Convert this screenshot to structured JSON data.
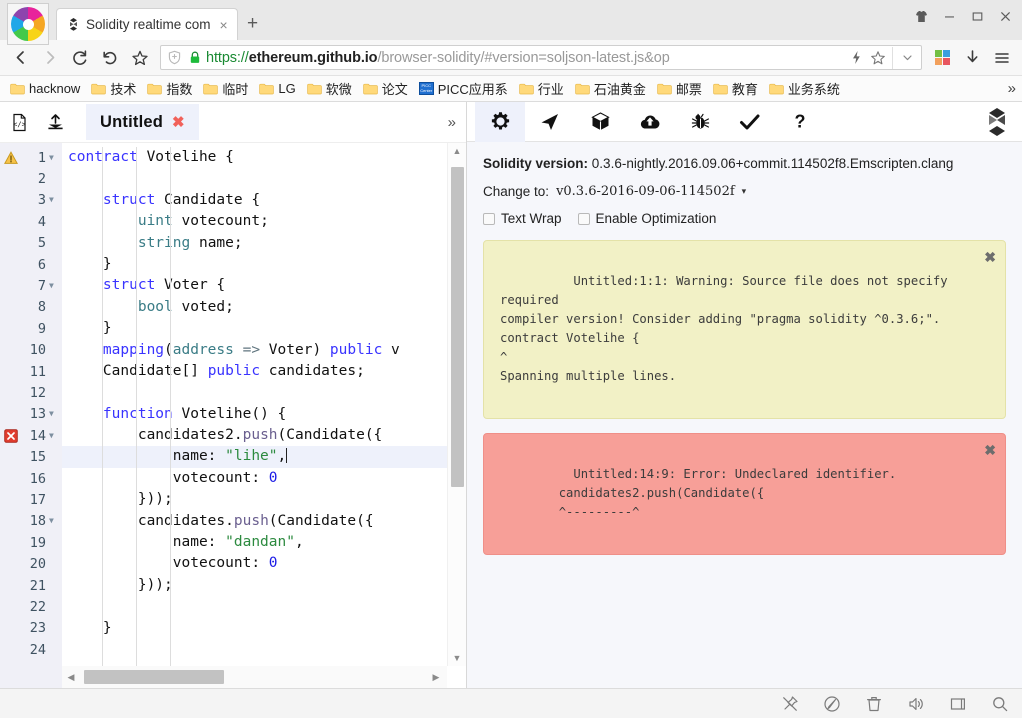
{
  "browser": {
    "logo_icon": "pinwheel-logo",
    "tab": {
      "title": "Solidity realtime com",
      "favicon_icon": "solidity-favicon",
      "close_label": "×"
    },
    "new_tab_label": "+",
    "window_controls": [
      {
        "name": "theme-shirt-icon",
        "label": "theme"
      },
      {
        "name": "minimize-button",
        "label": "minimize"
      },
      {
        "name": "maximize-button",
        "label": "maximize"
      },
      {
        "name": "close-button",
        "label": "close"
      }
    ],
    "nav": {
      "back_icon": "back-arrow-icon",
      "forward_icon": "forward-arrow-icon",
      "reload_icon": "reload-icon",
      "undo_icon": "undo-icon",
      "star_icon": "star-icon"
    },
    "url": {
      "scheme": "https://",
      "host": "ethereum.github.io",
      "path": "/browser-solidity/#version=soljson-latest.js&op",
      "full": "https://ethereum.github.io/browser-solidity/#version=soljson-latest.js&op",
      "lock_icon": "lock-icon",
      "shield_icon": "shield-plus-icon"
    },
    "url_icons": [
      {
        "name": "lightning-icon",
        "label": "⚡"
      },
      {
        "name": "star-outline-icon",
        "label": "☆"
      },
      {
        "name": "chevron-down-icon",
        "label": "⌄"
      },
      {
        "name": "extensions-grid-icon",
        "label": "apps"
      },
      {
        "name": "downloads-icon",
        "label": "↓"
      },
      {
        "name": "menu-icon",
        "label": "☰"
      }
    ],
    "bookmarks": [
      {
        "label": "hacknow",
        "icon": "folder-icon"
      },
      {
        "label": "技术",
        "icon": "folder-icon"
      },
      {
        "label": "指数",
        "icon": "folder-icon"
      },
      {
        "label": "临时",
        "icon": "folder-icon"
      },
      {
        "label": "LG",
        "icon": "folder-icon"
      },
      {
        "label": "软微",
        "icon": "folder-icon"
      },
      {
        "label": "论文",
        "icon": "folder-icon"
      },
      {
        "label": "PICC应用系",
        "icon": "picc-icon"
      },
      {
        "label": "行业",
        "icon": "folder-icon"
      },
      {
        "label": "石油黄金",
        "icon": "folder-icon"
      },
      {
        "label": "邮票",
        "icon": "folder-icon"
      },
      {
        "label": "教育",
        "icon": "folder-icon"
      },
      {
        "label": "业务系统",
        "icon": "folder-icon"
      }
    ],
    "bookmarks_overflow": "»"
  },
  "editor": {
    "toolbar": {
      "new_file_icon": "new-file-icon",
      "upload_icon": "upload-icon",
      "expand_label": "»"
    },
    "file_tab": {
      "name": "Untitled",
      "close_label": "✖"
    },
    "active_line": 15,
    "lines": [
      {
        "n": 1,
        "fold": true,
        "marker": "warning",
        "tokens": [
          {
            "t": "contract ",
            "c": "kw"
          },
          {
            "t": "Votelihe {",
            "c": ""
          }
        ],
        "indent": 0
      },
      {
        "n": 2,
        "fold": false,
        "marker": "",
        "tokens": [],
        "indent": 0
      },
      {
        "n": 3,
        "fold": true,
        "marker": "",
        "tokens": [
          {
            "t": "    ",
            "c": ""
          },
          {
            "t": "struct ",
            "c": "kw"
          },
          {
            "t": "Candidate {",
            "c": ""
          }
        ],
        "indent": 1
      },
      {
        "n": 4,
        "fold": false,
        "marker": "",
        "tokens": [
          {
            "t": "        ",
            "c": ""
          },
          {
            "t": "uint",
            "c": "typ"
          },
          {
            "t": " votecount;",
            "c": ""
          }
        ],
        "indent": 2
      },
      {
        "n": 5,
        "fold": false,
        "marker": "",
        "tokens": [
          {
            "t": "        ",
            "c": ""
          },
          {
            "t": "string",
            "c": "typ"
          },
          {
            "t": " name;",
            "c": ""
          }
        ],
        "indent": 2
      },
      {
        "n": 6,
        "fold": false,
        "marker": "",
        "tokens": [
          {
            "t": "    }",
            "c": ""
          }
        ],
        "indent": 1
      },
      {
        "n": 7,
        "fold": true,
        "marker": "",
        "tokens": [
          {
            "t": "    ",
            "c": ""
          },
          {
            "t": "struct ",
            "c": "kw"
          },
          {
            "t": "Voter {",
            "c": ""
          }
        ],
        "indent": 1
      },
      {
        "n": 8,
        "fold": false,
        "marker": "",
        "tokens": [
          {
            "t": "        ",
            "c": ""
          },
          {
            "t": "bool",
            "c": "typ"
          },
          {
            "t": " voted;",
            "c": ""
          }
        ],
        "indent": 2
      },
      {
        "n": 9,
        "fold": false,
        "marker": "",
        "tokens": [
          {
            "t": "    }",
            "c": ""
          }
        ],
        "indent": 1
      },
      {
        "n": 10,
        "fold": false,
        "marker": "",
        "tokens": [
          {
            "t": "    ",
            "c": ""
          },
          {
            "t": "mapping",
            "c": "kw"
          },
          {
            "t": "(",
            "c": ""
          },
          {
            "t": "address",
            "c": "typ"
          },
          {
            "t": " ",
            "c": ""
          },
          {
            "t": "=>",
            "c": "op"
          },
          {
            "t": " Voter) ",
            "c": ""
          },
          {
            "t": "public",
            "c": "kw"
          },
          {
            "t": " v",
            "c": ""
          }
        ],
        "indent": 1
      },
      {
        "n": 11,
        "fold": false,
        "marker": "",
        "tokens": [
          {
            "t": "    Candidate[] ",
            "c": ""
          },
          {
            "t": "public",
            "c": "kw"
          },
          {
            "t": " candidates;",
            "c": ""
          }
        ],
        "indent": 1
      },
      {
        "n": 12,
        "fold": false,
        "marker": "",
        "tokens": [],
        "indent": 0
      },
      {
        "n": 13,
        "fold": true,
        "marker": "",
        "tokens": [
          {
            "t": "    ",
            "c": ""
          },
          {
            "t": "function ",
            "c": "kw"
          },
          {
            "t": "Votelihe() {",
            "c": ""
          }
        ],
        "indent": 1
      },
      {
        "n": 14,
        "fold": true,
        "marker": "error",
        "tokens": [
          {
            "t": "        candidates2.",
            "c": ""
          },
          {
            "t": "push",
            "c": "fn"
          },
          {
            "t": "(Candidate({",
            "c": ""
          }
        ],
        "indent": 2
      },
      {
        "n": 15,
        "fold": false,
        "marker": "",
        "tokens": [
          {
            "t": "            name: ",
            "c": ""
          },
          {
            "t": "\"lihe\"",
            "c": "str"
          },
          {
            "t": ",",
            "c": ""
          }
        ],
        "indent": 3,
        "caret": true
      },
      {
        "n": 16,
        "fold": false,
        "marker": "",
        "tokens": [
          {
            "t": "            votecount: ",
            "c": ""
          },
          {
            "t": "0",
            "c": "num2"
          }
        ],
        "indent": 3
      },
      {
        "n": 17,
        "fold": false,
        "marker": "",
        "tokens": [
          {
            "t": "        }));",
            "c": ""
          }
        ],
        "indent": 2
      },
      {
        "n": 18,
        "fold": true,
        "marker": "",
        "tokens": [
          {
            "t": "        candidates.",
            "c": ""
          },
          {
            "t": "push",
            "c": "fn"
          },
          {
            "t": "(Candidate({",
            "c": ""
          }
        ],
        "indent": 2
      },
      {
        "n": 19,
        "fold": false,
        "marker": "",
        "tokens": [
          {
            "t": "            name: ",
            "c": ""
          },
          {
            "t": "\"dandan\"",
            "c": "str"
          },
          {
            "t": ",",
            "c": ""
          }
        ],
        "indent": 3
      },
      {
        "n": 20,
        "fold": false,
        "marker": "",
        "tokens": [
          {
            "t": "            votecount: ",
            "c": ""
          },
          {
            "t": "0",
            "c": "num2"
          }
        ],
        "indent": 3
      },
      {
        "n": 21,
        "fold": false,
        "marker": "",
        "tokens": [
          {
            "t": "        }));",
            "c": ""
          }
        ],
        "indent": 2
      },
      {
        "n": 22,
        "fold": false,
        "marker": "",
        "tokens": [],
        "indent": 0
      },
      {
        "n": 23,
        "fold": false,
        "marker": "",
        "tokens": [
          {
            "t": "    }",
            "c": ""
          }
        ],
        "indent": 1
      },
      {
        "n": 24,
        "fold": false,
        "marker": "",
        "tokens": [],
        "indent": 0
      }
    ]
  },
  "panel": {
    "tabs": [
      {
        "name": "settings-tab",
        "icon": "gear-icon",
        "active": true
      },
      {
        "name": "run-tab",
        "icon": "paper-plane-icon",
        "active": false
      },
      {
        "name": "compile-tab",
        "icon": "cube-icon",
        "active": false
      },
      {
        "name": "publish-tab",
        "icon": "cloud-upload-icon",
        "active": false
      },
      {
        "name": "debugger-tab",
        "icon": "bug-icon",
        "active": false
      },
      {
        "name": "analysis-tab",
        "icon": "check-icon",
        "active": false
      },
      {
        "name": "help-tab",
        "icon": "question-mark-icon",
        "active": false
      }
    ],
    "swarm_logo_icon": "solidity-s-logo-icon",
    "solidity_version_label": "Solidity version:",
    "solidity_version_value": "0.3.6-nightly.2016.09.06+commit.114502f8.Emscripten.clang",
    "change_to_label": "Change to:",
    "change_to_value": "v0.3.6-2016-09-06-114502f",
    "change_to_arrow": "▾",
    "text_wrap_label": "Text Wrap",
    "text_wrap_checked": false,
    "enable_optimization_label": "Enable Optimization",
    "enable_optimization_checked": false,
    "messages": [
      {
        "type": "warning",
        "close_label": "✖",
        "text": "Untitled:1:1: Warning: Source file does not specify required\ncompiler version! Consider adding \"pragma solidity ^0.3.6;\".\ncontract Votelihe {\n^\nSpanning multiple lines."
      },
      {
        "type": "error",
        "close_label": "✖",
        "text": "Untitled:14:9: Error: Undeclared identifier.\n        candidates2.push(Candidate({\n        ^---------^"
      }
    ]
  },
  "statusbar": {
    "icons": [
      {
        "name": "pin-off-icon",
        "label": "pin"
      },
      {
        "name": "annotate-pen-icon",
        "label": "annotate"
      },
      {
        "name": "trash-icon",
        "label": "trash"
      },
      {
        "name": "speaker-icon",
        "label": "sound"
      },
      {
        "name": "window-icon",
        "label": "window"
      },
      {
        "name": "search-icon",
        "label": "search"
      }
    ]
  },
  "colors": {
    "accent": "#3933ff",
    "warning_bg": "#f2f1c6",
    "error_bg": "#f79f98",
    "active_line": "#eef1fb",
    "secure_green": "#1a8a33"
  }
}
